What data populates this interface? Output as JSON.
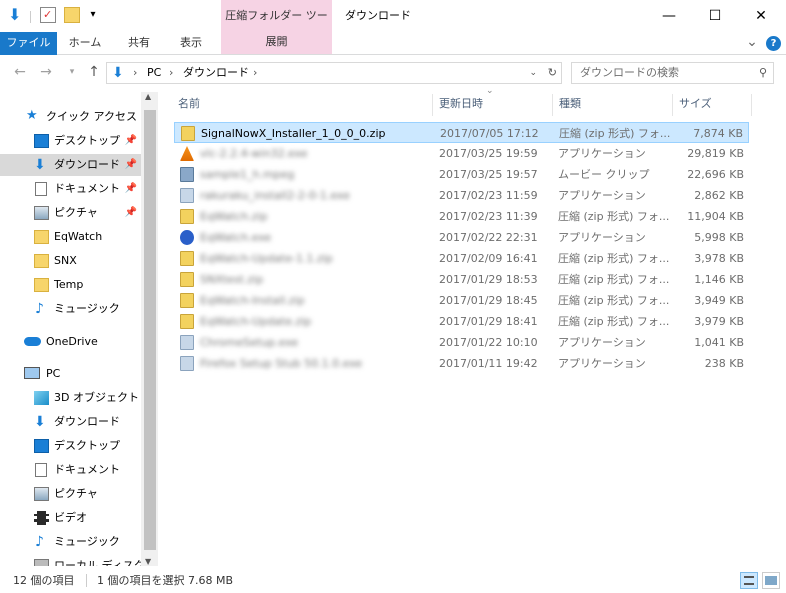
{
  "titlebar": {
    "context_tab": "圧縮フォルダー ツール",
    "title": "ダウンロード",
    "minimize": "—",
    "maximize": "☐",
    "close": "✕"
  },
  "ribbon": {
    "tabs": [
      "ファイル",
      "ホーム",
      "共有",
      "表示",
      "展開"
    ],
    "expand_glyph": "⌄",
    "help_glyph": "?"
  },
  "address": {
    "path": [
      "PC",
      "ダウンロード"
    ],
    "search_placeholder": "ダウンロードの検索"
  },
  "navpane": {
    "quick_access": "クイック アクセス",
    "quick_items": [
      {
        "label": "デスクトップ",
        "pinned": true
      },
      {
        "label": "ダウンロード",
        "pinned": true
      },
      {
        "label": "ドキュメント",
        "pinned": true
      },
      {
        "label": "ピクチャ",
        "pinned": true
      },
      {
        "label": "EqWatch",
        "pinned": false
      },
      {
        "label": "SNX",
        "pinned": false
      },
      {
        "label": "Temp",
        "pinned": false
      },
      {
        "label": "ミュージック",
        "pinned": false
      }
    ],
    "onedrive": "OneDrive",
    "pc": "PC",
    "pc_items": [
      "3D オブジェクト",
      "ダウンロード",
      "デスクトップ",
      "ドキュメント",
      "ピクチャ",
      "ビデオ",
      "ミュージック",
      "ローカル ディスク (C"
    ]
  },
  "list": {
    "headers": {
      "name": "名前",
      "date": "更新日時",
      "type": "種類",
      "size": "サイズ"
    },
    "files": [
      {
        "name": "SignalNowX_Installer_1_0_0_0.zip",
        "date": "2017/07/05 17:12",
        "type": "圧縮 (zip 形式) フォ...",
        "size": "7,874 KB",
        "kind": "zip",
        "selected": true
      },
      {
        "name": "vlc-2.2.4-win32.exe",
        "date": "2017/03/25 19:59",
        "type": "アプリケーション",
        "size": "29,819 KB",
        "kind": "vlc",
        "selected": false
      },
      {
        "name": "sample1_h.mpeg",
        "date": "2017/03/25 19:57",
        "type": "ムービー クリップ",
        "size": "22,696 KB",
        "kind": "movie",
        "selected": false
      },
      {
        "name": "rakuraku_install2-2-0-1.exe",
        "date": "2017/02/23 11:59",
        "type": "アプリケーション",
        "size": "2,862 KB",
        "kind": "app",
        "selected": false
      },
      {
        "name": "EqWatch.zip",
        "date": "2017/02/23 11:39",
        "type": "圧縮 (zip 形式) フォ...",
        "size": "11,904 KB",
        "kind": "zip",
        "selected": false
      },
      {
        "name": "EqWatch.exe",
        "date": "2017/02/22 22:31",
        "type": "アプリケーション",
        "size": "5,998 KB",
        "kind": "app-blue",
        "selected": false
      },
      {
        "name": "EqWatch-Update-1.1.zip",
        "date": "2017/02/09 16:41",
        "type": "圧縮 (zip 形式) フォ...",
        "size": "3,978 KB",
        "kind": "zip",
        "selected": false
      },
      {
        "name": "SNXtest.zip",
        "date": "2017/01/29 18:53",
        "type": "圧縮 (zip 形式) フォ...",
        "size": "1,146 KB",
        "kind": "zip",
        "selected": false
      },
      {
        "name": "EqWatch-Install.zip",
        "date": "2017/01/29 18:45",
        "type": "圧縮 (zip 形式) フォ...",
        "size": "3,949 KB",
        "kind": "zip",
        "selected": false
      },
      {
        "name": "EqWatch-Update.zip",
        "date": "2017/01/29 18:41",
        "type": "圧縮 (zip 形式) フォ...",
        "size": "3,979 KB",
        "kind": "zip",
        "selected": false
      },
      {
        "name": "ChromeSetup.exe",
        "date": "2017/01/22 10:10",
        "type": "アプリケーション",
        "size": "1,041 KB",
        "kind": "app",
        "selected": false
      },
      {
        "name": "Firefox Setup Stub 50.1.0.exe",
        "date": "2017/01/11 19:42",
        "type": "アプリケーション",
        "size": "238 KB",
        "kind": "app",
        "selected": false
      }
    ]
  },
  "status": {
    "count": "12 個の項目",
    "selection": "1 個の項目を選択  7.68 MB"
  },
  "colors": {
    "accent": "#1979ca",
    "selected_row": "#cce8ff",
    "context_tab": "#f6d3e4"
  }
}
